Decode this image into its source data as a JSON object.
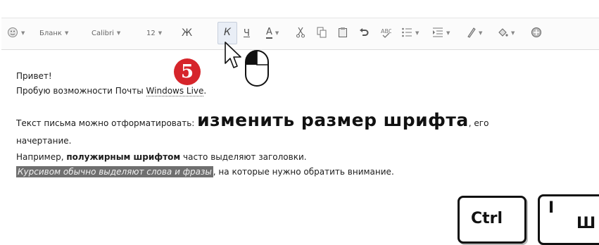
{
  "toolbar": {
    "style_label": "Бланк",
    "font_label": "Calibri",
    "size_label": "12",
    "bold_glyph": "Ж",
    "italic_glyph": "К",
    "underline_glyph": "Ч",
    "color_glyph": "А"
  },
  "message": {
    "line1": "Привет!",
    "line2_a": "Пробую возможности Почты ",
    "line2_b": "Windows Live",
    "line2_c": ".",
    "line3_a": "Текст письма можно отформатировать: ",
    "line3_big": "изменить размер шрифта",
    "line3_b": ", его",
    "line4": "начертание.",
    "line5_a": "Например, ",
    "line5_bold": "полужирным шрифтом",
    "line5_b": " часто выделяют заголовки.",
    "line6_italic": "Курсивом обычно выделяют слова и фразы",
    "line6_rest": ", на которые нужно обратить внимание."
  },
  "overlay": {
    "step_number": "5",
    "key_ctrl": "Ctrl",
    "key_right_top": "I",
    "key_right_bottom": "Ш"
  },
  "colors": {
    "badge": "#d6252b",
    "selection": "#6f6f6f"
  }
}
